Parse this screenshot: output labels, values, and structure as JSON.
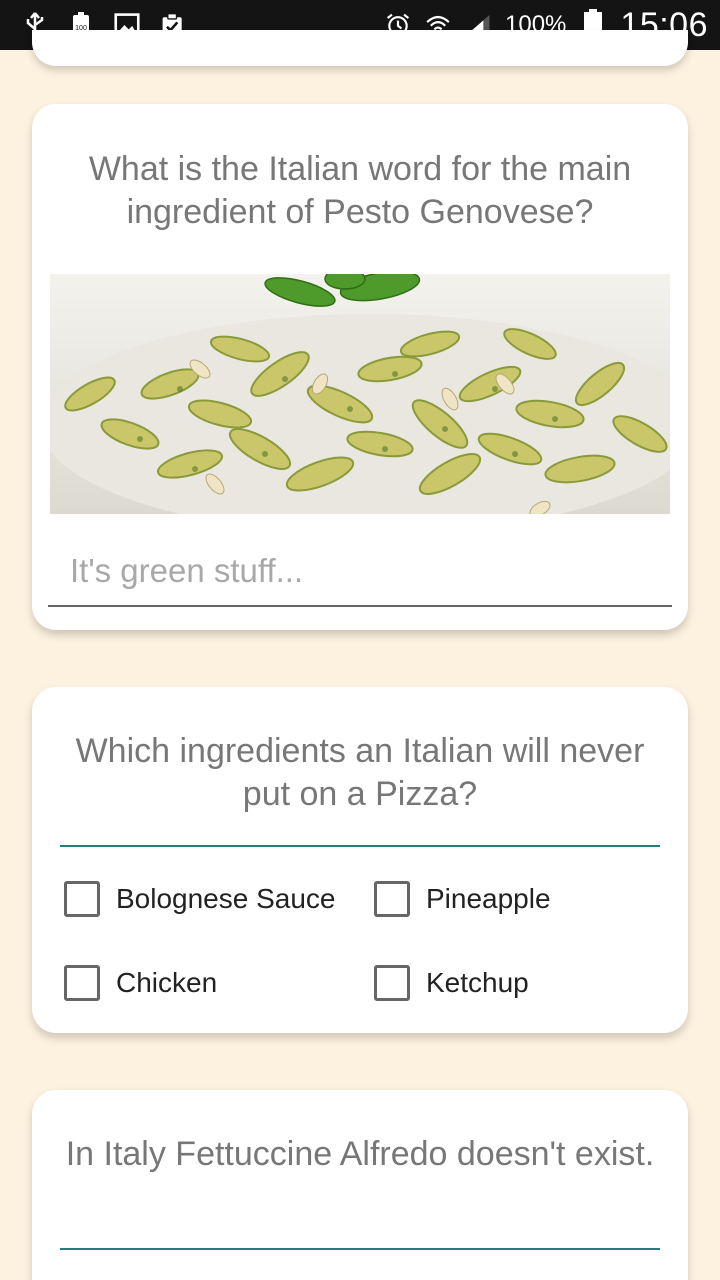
{
  "status_bar": {
    "battery_percent": "100%",
    "time": "15:06",
    "left_icons": [
      "usb-icon",
      "battery-saver-icon",
      "image-icon",
      "clipboard-check-icon"
    ],
    "right_icons": [
      "alarm-icon",
      "wifi-icon",
      "signal-icon",
      "battery-icon"
    ]
  },
  "card1": {
    "question": "What is the Italian word for the main ingredient of Pesto Genovese?",
    "image": "pesto-pasta-photo",
    "answer_placeholder": "It's green stuff..."
  },
  "card2": {
    "question": "Which ingredients an Italian will never put on a Pizza?",
    "options": [
      "Bolognese Sauce",
      "Pineapple",
      "Chicken",
      "Ketchup"
    ]
  },
  "card3": {
    "question": "In Italy Fettuccine Alfredo doesn't exist."
  },
  "colors": {
    "background": "#fdf1df",
    "card": "#ffffff",
    "accent": "#1f7f79",
    "question_text": "#777777"
  }
}
